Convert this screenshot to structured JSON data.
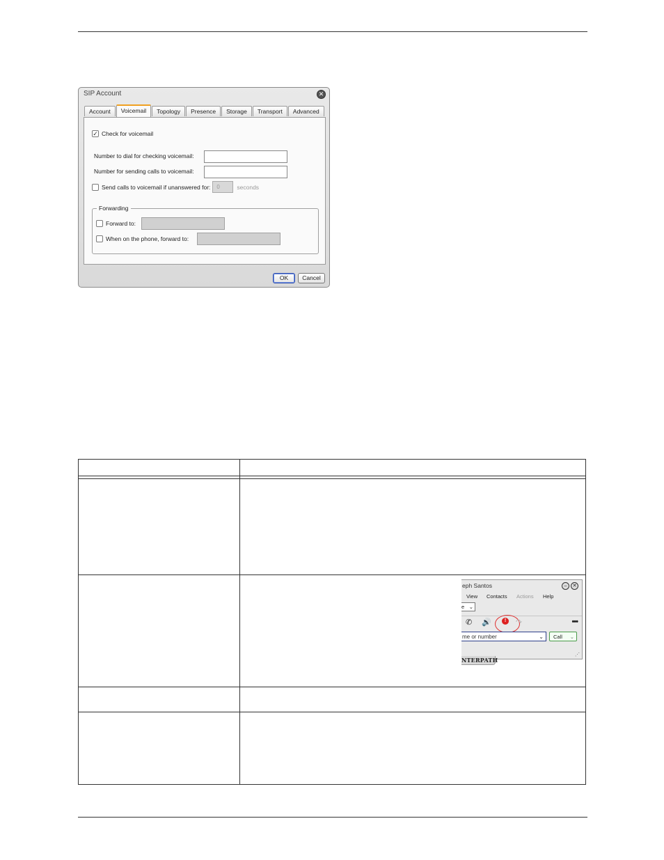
{
  "dialog": {
    "title": "SIP Account",
    "tabs": [
      "Account",
      "Voicemail",
      "Topology",
      "Presence",
      "Storage",
      "Transport",
      "Advanced"
    ],
    "active_tab": "Voicemail",
    "check_voicemail_label": "Check for voicemail",
    "check_voicemail_checked": true,
    "number_check_label": "Number to dial for checking voicemail:",
    "number_check_value": "",
    "number_send_label": "Number for sending calls to voicemail:",
    "number_send_value": "",
    "send_unanswered_label": "Send calls to voicemail if unanswered for:",
    "send_unanswered_value": "0",
    "seconds_label": "seconds",
    "forwarding": {
      "legend": "Forwarding",
      "forward_to_label": "Forward to:",
      "on_phone_label": "When on the phone, forward to:"
    },
    "ok_label": "OK",
    "cancel_label": "Cancel"
  },
  "mini_app": {
    "title": "eph Santos",
    "menu": [
      "View",
      "Contacts",
      "Actions",
      "Help"
    ],
    "select_value": "e",
    "input_placeholder": "me or number",
    "call_label": "Call",
    "brand": "NTERPATH"
  }
}
